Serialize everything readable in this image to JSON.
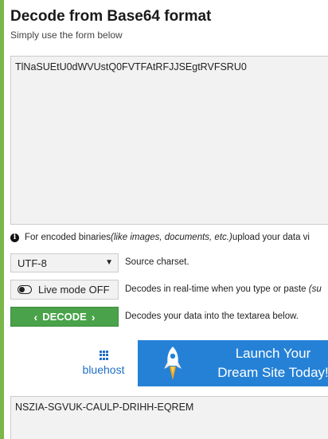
{
  "header": {
    "title": "Decode from Base64 format",
    "subtitle": "Simply use the form below"
  },
  "input": {
    "value": "TlNaSUEtU0dWVUstQ0FVTFAtRFJJSEgtRVFSRU0"
  },
  "info": {
    "icon": "info-icon",
    "text_before": "For encoded binaries ",
    "text_italic": "(like images, documents, etc.)",
    "text_after": " upload your data vi"
  },
  "charset": {
    "selected": "UTF-8",
    "hint": "Source charset."
  },
  "live_mode": {
    "label": "Live mode OFF",
    "hint_before": "Decodes in real-time when you type or paste ",
    "hint_italic": "(su"
  },
  "decode": {
    "chevron_left": "‹",
    "label": "DECODE",
    "chevron_right": "›",
    "hint": "Decodes your data into the textarea below."
  },
  "ad": {
    "logo_text": "bluehost",
    "line1": "Launch Your",
    "line2": "Dream Site Today!",
    "background": "#2581d6"
  },
  "output": {
    "value": "NSZIA-SGVUK-CAULP-DRIHH-EQREM"
  },
  "colors": {
    "page_background": "#7ab648",
    "decode_button": "#4aa34a",
    "brand_blue": "#1e6fc7"
  }
}
